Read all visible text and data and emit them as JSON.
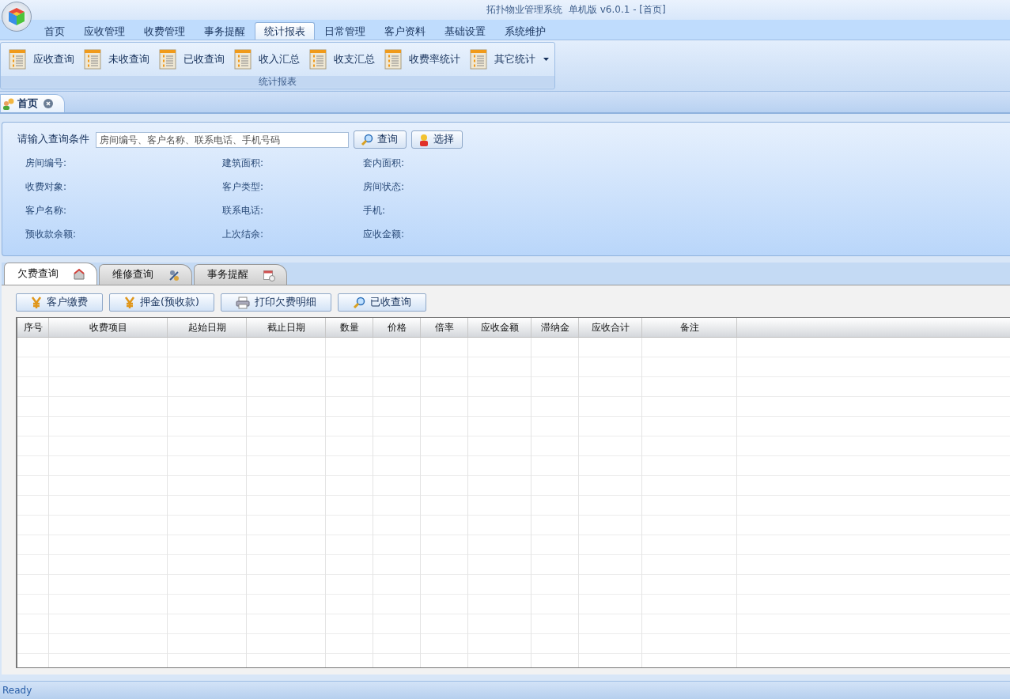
{
  "window": {
    "title": "拓扑物业管理系统  单机版 v6.0.1 - [首页]"
  },
  "menu_tabs": [
    {
      "label": "首页",
      "selected": false
    },
    {
      "label": "应收管理",
      "selected": false
    },
    {
      "label": "收费管理",
      "selected": false
    },
    {
      "label": "事务提醒",
      "selected": false
    },
    {
      "label": "统计报表",
      "selected": true
    },
    {
      "label": "日常管理",
      "selected": false
    },
    {
      "label": "客户资料",
      "selected": false
    },
    {
      "label": "基础设置",
      "selected": false
    },
    {
      "label": "系统维护",
      "selected": false
    }
  ],
  "ribbon": {
    "group_label": "统计报表",
    "buttons": [
      "应收查询",
      "未收查询",
      "已收查询",
      "收入汇总",
      "收支汇总",
      "收费率统计",
      "其它统计"
    ]
  },
  "document_tab": {
    "label": "首页"
  },
  "query": {
    "label": "请输入查询条件",
    "placeholder": "房间编号、客户名称、联系电话、手机号码",
    "buttons": [
      "查询",
      "选择"
    ]
  },
  "info_fields": [
    [
      "房间编号:",
      "建筑面积:",
      "套内面积:"
    ],
    [
      "收费对象:",
      "客户类型:",
      "房间状态:"
    ],
    [
      "客户名称:",
      "联系电话:",
      "手机:"
    ],
    [
      "预收款余额:",
      "上次结余:",
      "应收金额:"
    ]
  ],
  "sub_tabs": [
    {
      "label": "欠费查询",
      "selected": true,
      "kind": "house"
    },
    {
      "label": "维修查询",
      "selected": false,
      "kind": "tools"
    },
    {
      "label": "事务提醒",
      "selected": false,
      "kind": "calendar"
    }
  ],
  "actions": [
    {
      "label": "客户缴费",
      "kind": "yen"
    },
    {
      "label": "押金(预收款)",
      "kind": "yen"
    },
    {
      "label": "打印欠费明细",
      "kind": "printer"
    },
    {
      "label": "已收查询",
      "kind": "search"
    }
  ],
  "table": {
    "columns": [
      "序号",
      "收费项目",
      "起始日期",
      "截止日期",
      "数量",
      "价格",
      "倍率",
      "应收金额",
      "滞纳金",
      "应收合计",
      "备注"
    ]
  },
  "status_bar": {
    "text": "Ready"
  }
}
